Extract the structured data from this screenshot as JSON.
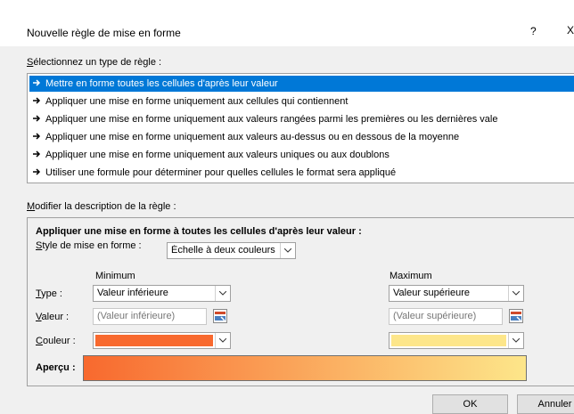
{
  "dialog": {
    "title": "Nouvelle règle de mise en forme",
    "help": "?",
    "close": "X"
  },
  "select_type": {
    "label_u": "S",
    "label_rest": "électionnez un type de règle :",
    "items": [
      {
        "label": "Mettre en forme toutes les cellules d'après leur valeur",
        "selected": true
      },
      {
        "label": "Appliquer une mise en forme uniquement aux cellules qui contiennent",
        "selected": false
      },
      {
        "label": "Appliquer une mise en forme uniquement aux valeurs rangées parmi les premières ou les dernières vale",
        "selected": false
      },
      {
        "label": "Appliquer une mise en forme uniquement aux valeurs au-dessus ou en dessous de la moyenne",
        "selected": false
      },
      {
        "label": "Appliquer une mise en forme uniquement aux valeurs uniques ou aux doublons",
        "selected": false
      },
      {
        "label": "Utiliser une formule pour déterminer pour quelles cellules le format sera appliqué",
        "selected": false
      }
    ]
  },
  "modify": {
    "label_u": "M",
    "label_rest": "odifier la description de la règle :",
    "heading": "Appliquer une mise en forme à toutes les cellules d'après leur valeur :",
    "style_label_u": "S",
    "style_label_rest": "tyle de mise en forme :",
    "style_value": "Échelle à deux couleurs",
    "minimum_header": "Minimum",
    "maximum_header": "Maximum",
    "type_label_u": "T",
    "type_label_rest": "ype :",
    "value_label_u": "V",
    "value_label_rest": "aleur :",
    "color_label_u": "C",
    "color_label_rest": "ouleur :",
    "min_type": "Valeur inférieure",
    "max_type": "Valeur supérieure",
    "min_value_placeholder": "(Valeur inférieure)",
    "max_value_placeholder": "(Valeur supérieure)",
    "min_color": "#f8692e",
    "max_color": "#fde68a",
    "preview_label": "Aperçu :"
  },
  "buttons": {
    "ok": "OK",
    "cancel": "Annuler"
  },
  "icons": {
    "arrow": "right-arrow-icon",
    "dropdown": "chevron-down-icon",
    "range_picker": "range-picker-icon"
  }
}
